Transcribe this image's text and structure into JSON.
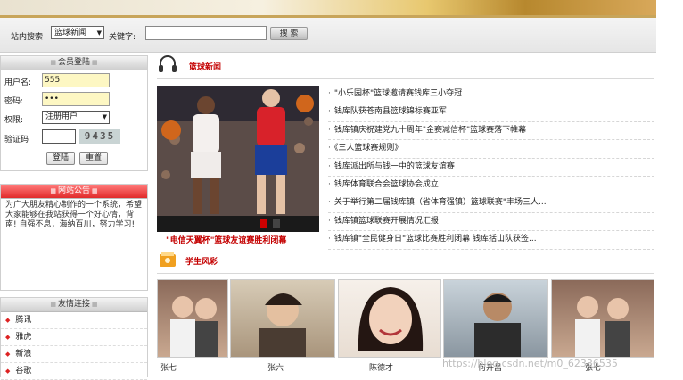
{
  "search": {
    "site_label": "站内搜索",
    "category_value": "篮球新闻",
    "keyword_label": "关键字:",
    "keyword_value": "",
    "search_button": "搜 索"
  },
  "login": {
    "title": "会员登陆",
    "username_label": "用户名:",
    "username_value": "555",
    "password_label": "密码:",
    "password_value": "•••",
    "role_label": "权限:",
    "role_value": "注册用户",
    "captcha_label": "验证码",
    "captcha_text": "9435",
    "login_button": "登陆",
    "reset_button": "重置"
  },
  "notice": {
    "title": "网站公告",
    "text": "为广大朋友精心制作的一个系统，希望大家能够在我站获得一个好心情，背南!        自强不息，海纳百川，努力学习!"
  },
  "links": {
    "title": "友情连接",
    "items": [
      "腾讯",
      "雅虎",
      "新浪",
      "谷歌"
    ]
  },
  "news": {
    "title": "篮球新闻",
    "caption": "\"电信天翼杯\"篮球友谊赛胜利闭幕",
    "items": [
      "\"小乐园杯\"篮球邀请赛钱库三小夺冠",
      "钱库队获苍南县篮球锦标赛亚军",
      "钱库镇庆祝建党九十周年\"金赛减信杯\"篮球赛落下帷幕",
      "《三人篮球赛规则》",
      "钱库派出所与钱一中的篮球友谊赛",
      "钱库体育联合会篮球协会成立",
      "关于举行第二届钱库镇（省体育强镇）篮球联赛\"丰场三人...",
      "钱库镇篮球联赛开展情况汇报",
      "钱库镇\"全民健身日\"篮球比赛胜利闭幕 钱库括山队获签..."
    ]
  },
  "students": {
    "title": "学生风彩",
    "names": [
      "张七",
      "张六",
      "陈德才",
      "何开昌",
      "张七"
    ]
  },
  "watermark": "https://blog.csdn.net/m0_62336535"
}
